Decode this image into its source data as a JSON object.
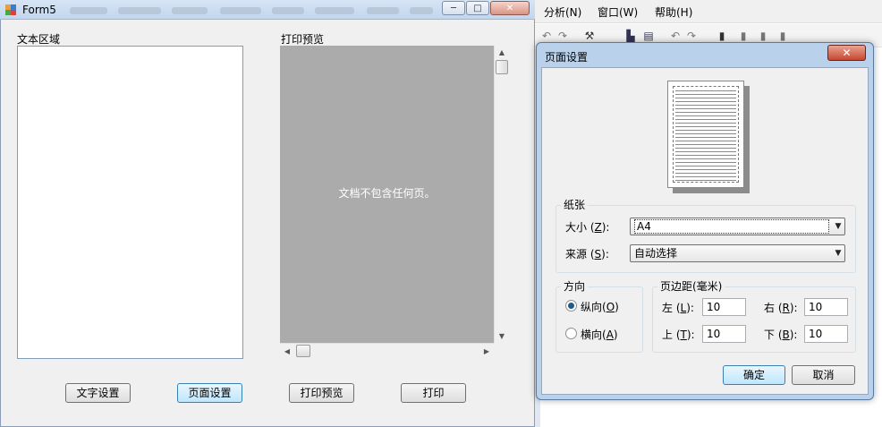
{
  "background_app": {
    "menu": [
      "分析(N)",
      "窗口(W)",
      "帮助(H)"
    ]
  },
  "form": {
    "title": "Form5",
    "text_area_label": "文本区域",
    "preview_label": "打印预览",
    "preview_message": "文档不包含任何页。",
    "buttons": {
      "font_settings": "文字设置",
      "page_setup": "页面设置",
      "print_preview": "打印预览",
      "print": "打印"
    },
    "controls": {
      "minimize": "─",
      "maximize": "□",
      "close": "✕"
    }
  },
  "dialog": {
    "title": "页面设置",
    "close": "✕",
    "paper": {
      "group_label": "纸张",
      "size_label": "大小",
      "size_key": "Z",
      "size_value": "A4",
      "source_label": "来源",
      "source_key": "S",
      "source_value": "自动选择"
    },
    "orientation": {
      "group_label": "方向",
      "portrait_label": "纵向",
      "portrait_key": "O",
      "landscape_label": "横向",
      "landscape_key": "A",
      "selected": "portrait"
    },
    "margins": {
      "group_label": "页边距(毫米)",
      "left_label": "左",
      "left_key": "L",
      "left_value": "10",
      "right_label": "右",
      "right_key": "R",
      "right_value": "10",
      "top_label": "上",
      "top_key": "T",
      "top_value": "10",
      "bottom_label": "下",
      "bottom_key": "B",
      "bottom_value": "10"
    },
    "ok": "确定",
    "cancel": "取消"
  }
}
